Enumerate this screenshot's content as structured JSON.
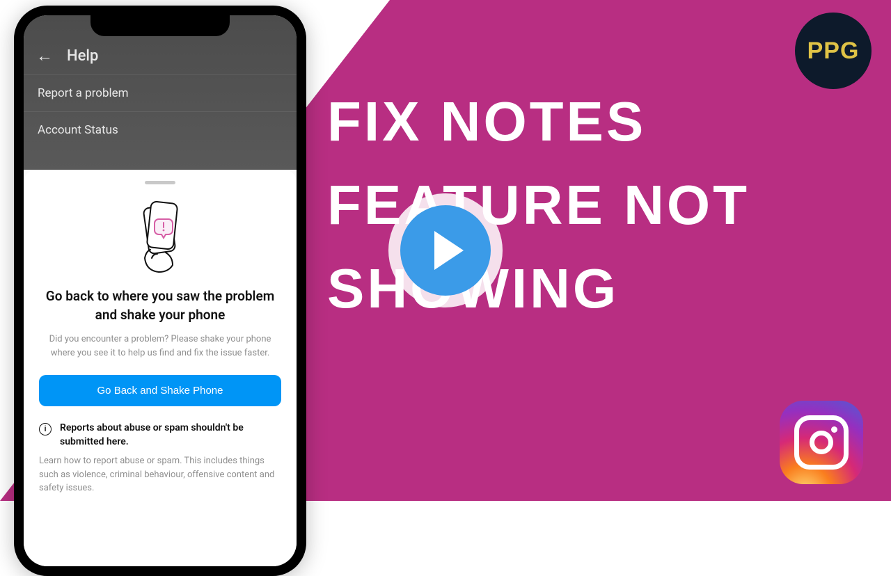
{
  "thumbnail": {
    "headline": "FIX  NOTES FEATURE NOT SHOWING",
    "badge_text": "PPG"
  },
  "phone": {
    "header_title": "Help",
    "menu": {
      "report": "Report a problem",
      "status": "Account Status"
    },
    "sheet": {
      "title": "Go back to where you saw the problem and shake your phone",
      "subtitle": "Did you encounter a problem? Please shake your phone where you see it to help us find and fix the issue faster.",
      "button": "Go Back and Shake Phone",
      "info_title": "Reports about abuse or spam shouldn't be submitted here.",
      "info_sub": "Learn how to report abuse or spam. This includes things such as violence, criminal behaviour, offensive content and safety issues."
    }
  },
  "colors": {
    "accent": "#b82e82",
    "button": "#0095f6",
    "play": "#3b9be8"
  }
}
